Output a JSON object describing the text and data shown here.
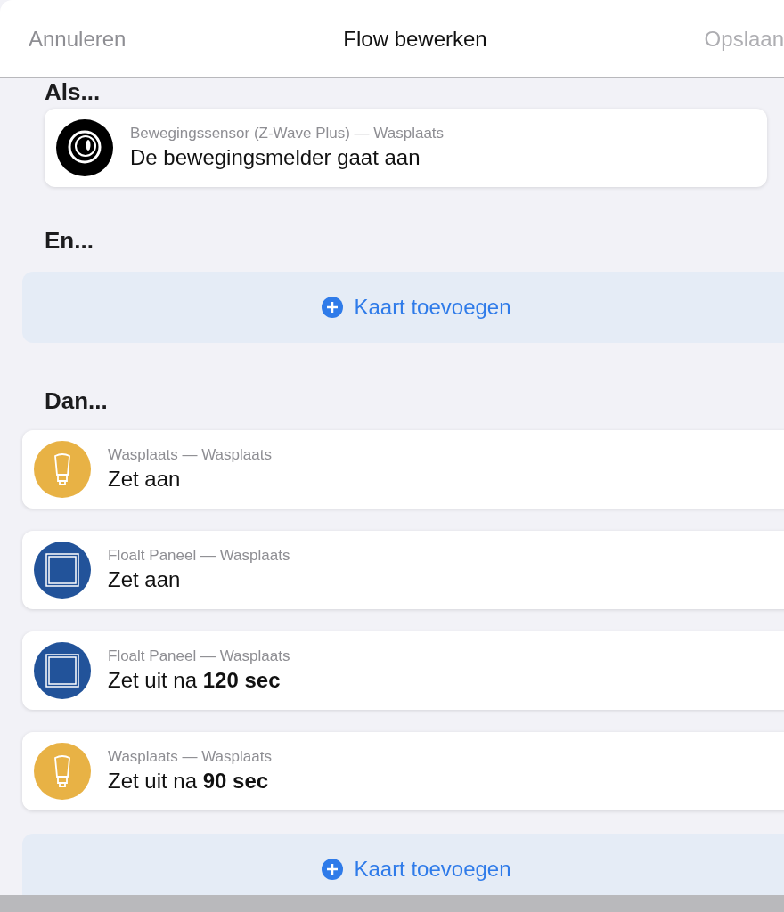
{
  "header": {
    "cancel": "Annuleren",
    "title": "Flow bewerken",
    "save": "Opslaan",
    "save_disabled": true
  },
  "sections": [
    {
      "heading": "Als...",
      "cards": [
        {
          "kind": "sensor",
          "subtitle": "Bewegingssensor (Z-Wave Plus) — Wasplaats",
          "title": "De bewegingsmelder gaat aan"
        }
      ]
    },
    {
      "heading": "En...",
      "add_button": "Kaart toevoegen"
    },
    {
      "heading": "Dan...",
      "cards": [
        {
          "kind": "bulb",
          "subtitle": "Wasplaats — Wasplaats",
          "title": "Zet aan"
        },
        {
          "kind": "panel",
          "subtitle": "Floalt Paneel — Wasplaats",
          "title": "Zet aan"
        },
        {
          "kind": "panel",
          "subtitle": "Floalt Paneel — Wasplaats",
          "title": "Zet uit na **120 sec**"
        },
        {
          "kind": "bulb",
          "subtitle": "Wasplaats — Wasplaats",
          "title": "Zet uit na **90 sec**"
        }
      ],
      "add_button": "Kaart toevoegen"
    }
  ]
}
